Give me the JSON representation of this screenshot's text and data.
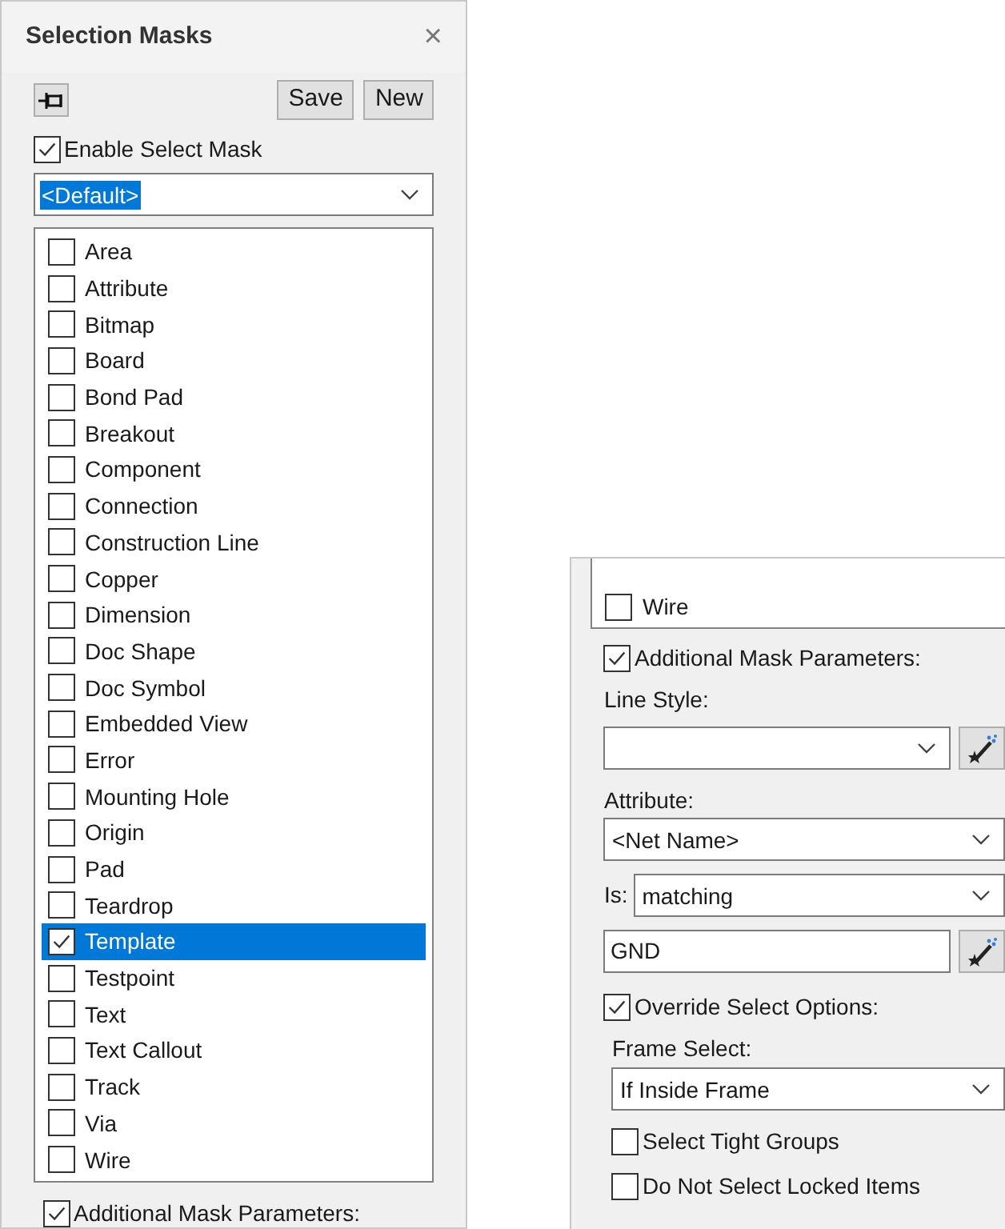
{
  "left_panel": {
    "title": "Selection Masks",
    "close": "×",
    "buttons": [
      "Save",
      "New"
    ],
    "enable_select_mask": {
      "label": "Enable Select Mask",
      "checked": true
    },
    "mask_dropdown": {
      "value": "<Default>"
    },
    "items": [
      {
        "label": "Area",
        "checked": false,
        "selected": false
      },
      {
        "label": "Attribute",
        "checked": false,
        "selected": false
      },
      {
        "label": "Bitmap",
        "checked": false,
        "selected": false
      },
      {
        "label": "Board",
        "checked": false,
        "selected": false
      },
      {
        "label": "Bond Pad",
        "checked": false,
        "selected": false
      },
      {
        "label": "Breakout",
        "checked": false,
        "selected": false
      },
      {
        "label": "Component",
        "checked": false,
        "selected": false
      },
      {
        "label": "Connection",
        "checked": false,
        "selected": false
      },
      {
        "label": "Construction Line",
        "checked": false,
        "selected": false
      },
      {
        "label": "Copper",
        "checked": false,
        "selected": false
      },
      {
        "label": "Dimension",
        "checked": false,
        "selected": false
      },
      {
        "label": "Doc Shape",
        "checked": false,
        "selected": false
      },
      {
        "label": "Doc Symbol",
        "checked": false,
        "selected": false
      },
      {
        "label": "Embedded View",
        "checked": false,
        "selected": false
      },
      {
        "label": "Error",
        "checked": false,
        "selected": false
      },
      {
        "label": "Mounting Hole",
        "checked": false,
        "selected": false
      },
      {
        "label": "Origin",
        "checked": false,
        "selected": false
      },
      {
        "label": "Pad",
        "checked": false,
        "selected": false
      },
      {
        "label": "Teardrop",
        "checked": false,
        "selected": false
      },
      {
        "label": "Template",
        "checked": true,
        "selected": true
      },
      {
        "label": "Testpoint",
        "checked": false,
        "selected": false
      },
      {
        "label": "Text",
        "checked": false,
        "selected": false
      },
      {
        "label": "Text Callout",
        "checked": false,
        "selected": false
      },
      {
        "label": "Track",
        "checked": false,
        "selected": false
      },
      {
        "label": "Via",
        "checked": false,
        "selected": false
      },
      {
        "label": "Wire",
        "checked": false,
        "selected": false
      }
    ],
    "additional_mask_parameters": {
      "label": "Additional Mask Parameters:",
      "checked": true
    }
  },
  "right_panel": {
    "items": [
      {
        "label": "Wire",
        "checked": false,
        "selected": false
      }
    ],
    "additional_mask_parameters": {
      "label": "Additional Mask Parameters:",
      "checked": true
    },
    "line_style": {
      "label": "Line Style:"
    },
    "attribute": {
      "label": "Attribute:",
      "value": "<Net Name>"
    },
    "is": {
      "label": "Is:",
      "value": "matching"
    },
    "match_value": {
      "value": "GND"
    },
    "override_select_options": {
      "label": "Override Select Options:",
      "checked": true
    },
    "frame_select": {
      "label": "Frame Select:",
      "value": "If Inside Frame"
    },
    "options": [
      {
        "label": "Select Tight Groups",
        "checked": false
      },
      {
        "label": "Do Not Select Locked Items",
        "checked": false
      }
    ]
  }
}
